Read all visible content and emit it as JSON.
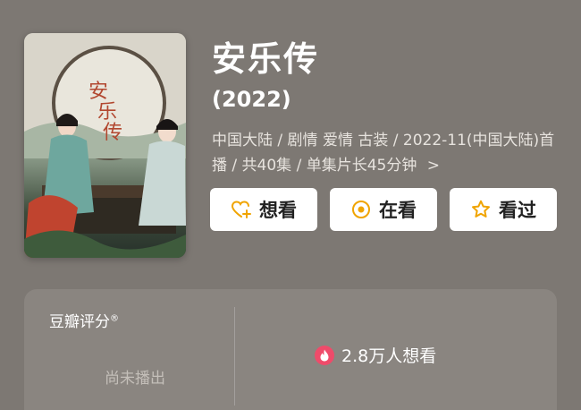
{
  "movie": {
    "title": "安乐传",
    "year": "(2022)",
    "meta_line": "中国大陆 / 剧情 爱情 古装 / 2022-11(中国大陆)首播 / 共40集 / 单集片长45分钟",
    "meta_chevron": ">"
  },
  "actions": {
    "want_label": "想看",
    "watching_label": "在看",
    "watched_label": "看过"
  },
  "rating": {
    "title": "豆瓣评分",
    "title_mark": "®",
    "status": "尚未播出",
    "want_count": "2.8万人想看"
  },
  "colors": {
    "accent": "#f0a400",
    "heart_badge": "#ef4b6a",
    "background": "#7d7873"
  },
  "icons": {
    "want": "heart-plus-icon",
    "watching": "target-circle-icon",
    "watched": "star-outline-icon",
    "hot": "flame-icon"
  }
}
